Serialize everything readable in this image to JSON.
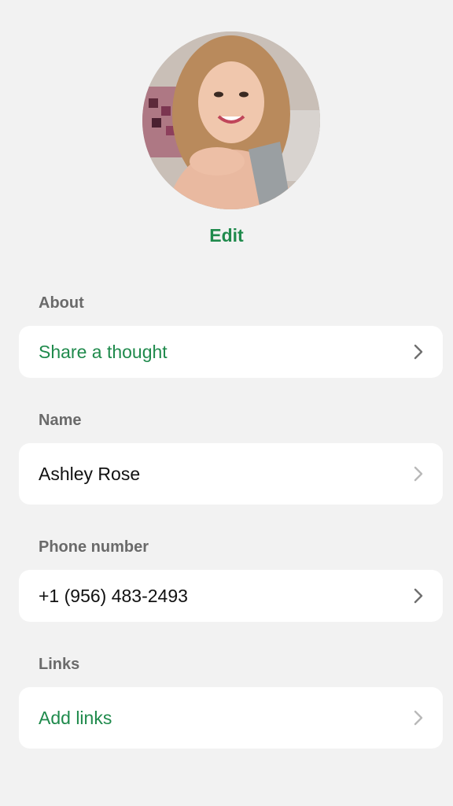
{
  "profile": {
    "photo_icon": "profile-photo",
    "edit_label": "Edit"
  },
  "about": {
    "label": "About",
    "value": "Share a thought"
  },
  "name": {
    "label": "Name",
    "value": "Ashley Rose"
  },
  "phone": {
    "label": "Phone number",
    "value": "+1 (956) 483-2493"
  },
  "links": {
    "label": "Links",
    "value": "Add links"
  },
  "colors": {
    "accent": "#1f8a4c",
    "background": "#f2f2f2",
    "card": "#ffffff",
    "label": "#6a6a6a"
  },
  "icons": {
    "row_action": "chevron-right-icon"
  }
}
